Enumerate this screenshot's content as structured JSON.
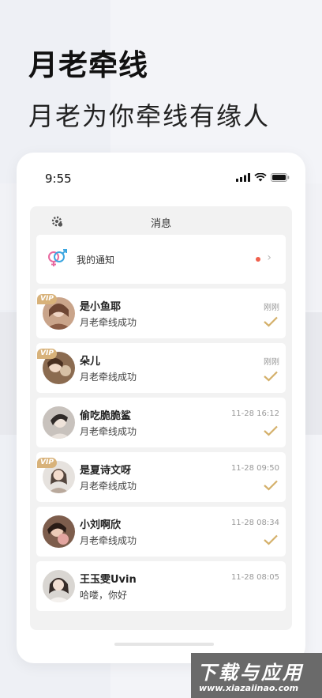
{
  "hero": {
    "title": "月老牵线",
    "subtitle": "月老为你牵线有缘人"
  },
  "status_bar": {
    "time": "9:55",
    "icons": [
      "signal-icon",
      "wifi-icon",
      "battery-icon"
    ]
  },
  "messages_panel": {
    "title": "消息",
    "settings_icon": "gear-icon",
    "notice": {
      "label": "我的通知",
      "icon": "gender-symbol-icon",
      "unread_dot": true
    },
    "items": [
      {
        "name": "是小鱼耶",
        "message": "月老牵线成功",
        "time": "刚刚",
        "vip": true,
        "vip_label": "VIP"
      },
      {
        "name": "朵儿",
        "message": "月老牵线成功",
        "time": "刚刚",
        "vip": true,
        "vip_label": "VIP"
      },
      {
        "name": "偷吃脆脆鲨",
        "message": "月老牵线成功",
        "time": "11-28 16:12",
        "vip": false
      },
      {
        "name": "是夏诗文呀",
        "message": "月老牵线成功",
        "time": "11-28 09:50",
        "vip": true,
        "vip_label": "VIP"
      },
      {
        "name": "小刘啊欣",
        "message": "月老牵线成功",
        "time": "11-28 08:34",
        "vip": false
      },
      {
        "name": "王玉雯Uvin",
        "message": "哈喽，你好",
        "time": "11-28 08:05",
        "vip": false
      }
    ]
  },
  "watermark": {
    "main": "下载与应用",
    "url": "www.xiazaiinao.com"
  },
  "colors": {
    "accent_gold": "#d4b06a",
    "vip_badge": "#d8b27a",
    "unread_dot": "#f0604d"
  }
}
